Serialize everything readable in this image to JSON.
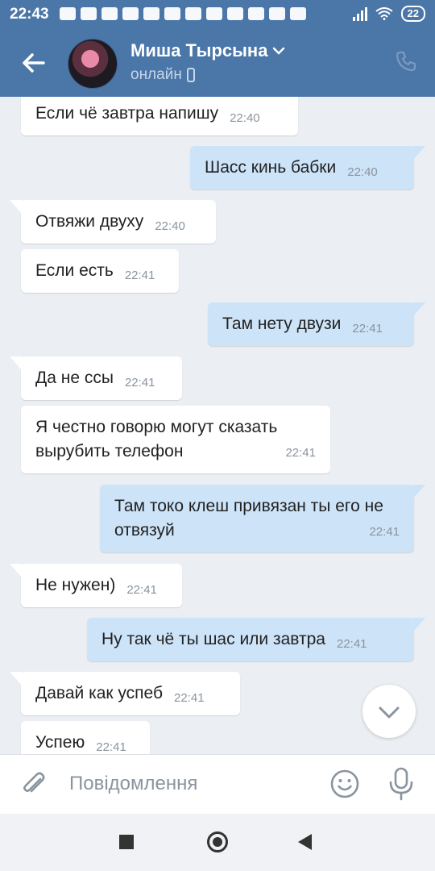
{
  "status_bar": {
    "time": "22:43",
    "battery": "22"
  },
  "header": {
    "contact_name": "Миша Тырсына",
    "status": "онлайн"
  },
  "messages": [
    {
      "dir": "in",
      "text": "Если чё завтра напишу",
      "time": "22:40"
    },
    {
      "dir": "out",
      "text": "Шасс кинь бабки",
      "time": "22:40"
    },
    {
      "dir": "in",
      "text": "Отвяжи двуху",
      "time": "22:40"
    },
    {
      "dir": "in",
      "text": "Если есть",
      "time": "22:41"
    },
    {
      "dir": "out",
      "text": "Там нету двузи",
      "time": "22:41"
    },
    {
      "dir": "in",
      "text": "Да не ссы",
      "time": "22:41"
    },
    {
      "dir": "in",
      "text": "Я честно говорю могут сказать вырубить телефон",
      "time": "22:41"
    },
    {
      "dir": "out",
      "text": "Там токо клеш привязан ты его не отвязуй",
      "time": "22:41"
    },
    {
      "dir": "in",
      "text": "Не нужен)",
      "time": "22:41"
    },
    {
      "dir": "out",
      "text": "Ну так чё ты шас или завтра",
      "time": "22:41"
    },
    {
      "dir": "in",
      "text": "Давай как успеб",
      "time": "22:41"
    },
    {
      "dir": "in",
      "text": "Успею",
      "time": "22:41"
    }
  ],
  "composer": {
    "placeholder": "Повідомлення"
  },
  "colors": {
    "header": "#4a76a8",
    "background": "#ebeef2",
    "incoming": "#ffffff",
    "outgoing": "#cce3f8"
  },
  "icons": [
    "back-arrow-icon",
    "chevron-down-icon",
    "phone-icon",
    "attach-icon",
    "emoji-icon",
    "mic-icon",
    "scroll-down-icon"
  ]
}
